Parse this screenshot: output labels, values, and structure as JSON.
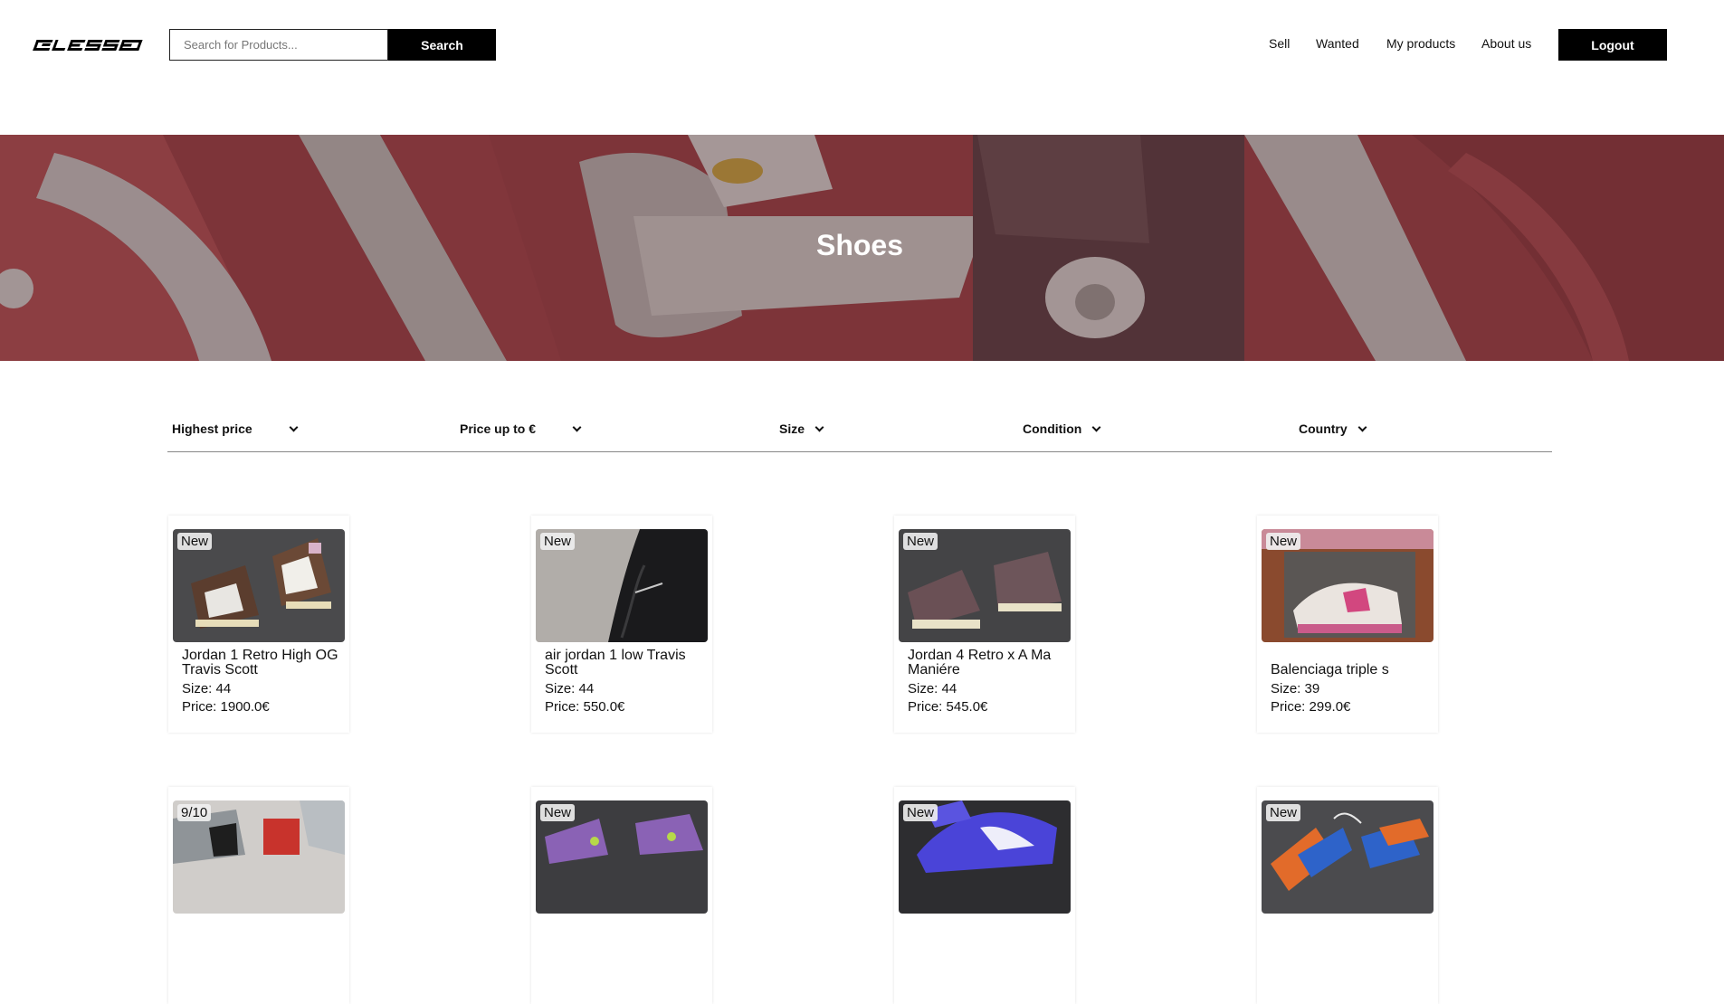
{
  "header": {
    "logo_text": "BLESSED",
    "search_placeholder": "Search for Products...",
    "search_label": "Search",
    "nav": [
      "Sell",
      "Wanted",
      "My products",
      "About us"
    ],
    "logout_label": "Logout"
  },
  "hero": {
    "title": "Shoes"
  },
  "filters": [
    "Highest price",
    "Price up to €",
    "Size",
    "Condition",
    "Country"
  ],
  "products": [
    {
      "badge": "New",
      "name": "Jordan 1 Retro High OG Travis Scott",
      "size": "Size: 44",
      "price": "Price: 1900.0€"
    },
    {
      "badge": "New",
      "name": "air jordan 1 low Travis Scott",
      "size": "Size: 44",
      "price": "Price: 550.0€"
    },
    {
      "badge": "New",
      "name": "Jordan 4 Retro x A Ma Maniére",
      "size": "Size: 44",
      "price": "Price: 545.0€"
    },
    {
      "badge": "New",
      "name": "Balenciaga triple s",
      "size": "Size: 39",
      "price": "Price: 299.0€"
    },
    {
      "badge": "9/10",
      "name": "",
      "size": "",
      "price": ""
    },
    {
      "badge": "New",
      "name": "",
      "size": "",
      "price": ""
    },
    {
      "badge": "New",
      "name": "",
      "size": "",
      "price": ""
    },
    {
      "badge": "New",
      "name": "",
      "size": "",
      "price": ""
    }
  ]
}
